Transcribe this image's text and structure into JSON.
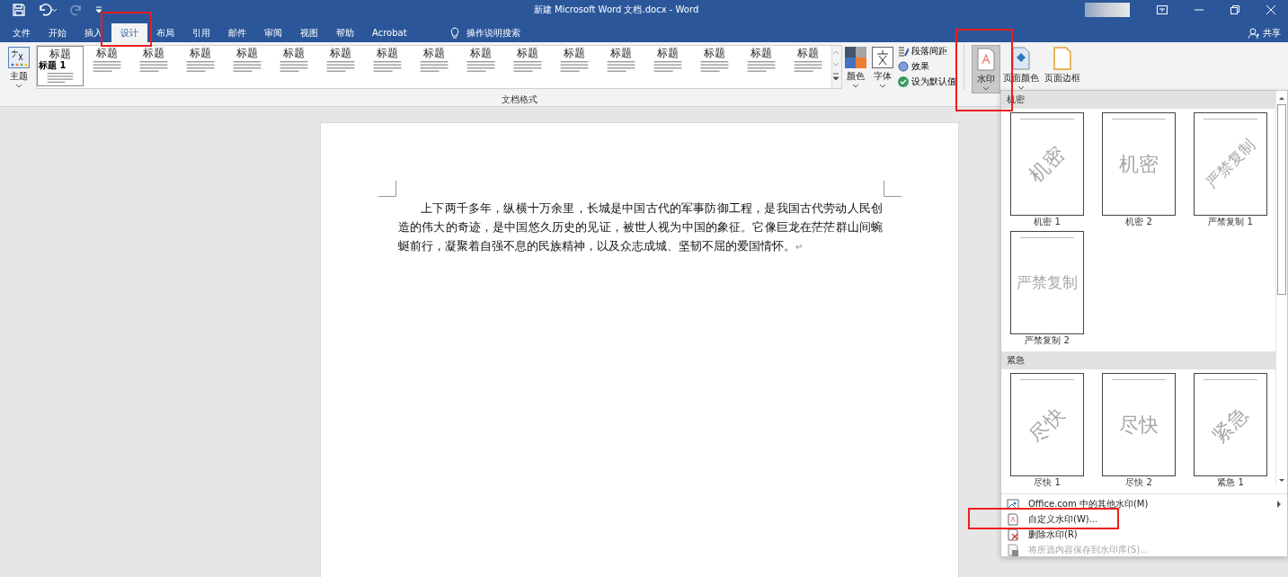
{
  "window": {
    "title": "新建 Microsoft Word 文档.docx  -  Word"
  },
  "tabs": [
    {
      "label": "文件",
      "selected": false,
      "highlighted": false
    },
    {
      "label": "开始",
      "selected": false,
      "highlighted": false
    },
    {
      "label": "插入",
      "selected": false,
      "highlighted": false
    },
    {
      "label": "设计",
      "selected": true,
      "highlighted": true
    },
    {
      "label": "布局",
      "selected": false,
      "highlighted": false
    },
    {
      "label": "引用",
      "selected": false,
      "highlighted": false
    },
    {
      "label": "邮件",
      "selected": false,
      "highlighted": false
    },
    {
      "label": "审阅",
      "selected": false,
      "highlighted": false
    },
    {
      "label": "视图",
      "selected": false,
      "highlighted": false
    },
    {
      "label": "帮助",
      "selected": false,
      "highlighted": false
    },
    {
      "label": "Acrobat",
      "selected": false,
      "highlighted": false
    }
  ],
  "tell_me": {
    "label": "操作说明搜索"
  },
  "share": {
    "label": "共享"
  },
  "ribbon": {
    "theme_button": {
      "label": "主题"
    },
    "style_gallery": [
      {
        "title": "标题",
        "heading": "标题 1"
      },
      {
        "title": "标题"
      },
      {
        "title": "标题"
      },
      {
        "title": "标题"
      },
      {
        "title": "标题"
      },
      {
        "title": "标题"
      },
      {
        "title": "标题"
      },
      {
        "title": "标题"
      },
      {
        "title": "标题"
      },
      {
        "title": "标题"
      },
      {
        "title": "标题"
      },
      {
        "title": "标题"
      },
      {
        "title": "标题"
      },
      {
        "title": "标题"
      },
      {
        "title": "标题"
      },
      {
        "title": "标题"
      },
      {
        "title": "标题"
      }
    ],
    "group_label": "文档格式",
    "colors": {
      "label": "颜色"
    },
    "fonts": {
      "label": "字体"
    },
    "paragraph_spacing": {
      "label": "段落间距"
    },
    "effects": {
      "label": "效果"
    },
    "set_default": {
      "label": "设为默认值"
    },
    "watermark": {
      "label": "水印",
      "pressed": true,
      "highlighted": true
    },
    "page_color": {
      "label": "页面颜色"
    },
    "page_borders": {
      "label": "页面边框"
    }
  },
  "document": {
    "paragraph": "上下两千多年，纵横十万余里，长城是中国古代的军事防御工程，是我国古代劳动人民创造的伟大的奇迹，是中国悠久历史的见证，被世人视为中国的象征。它像巨龙在茫茫群山间蜿蜒前行，凝聚着自强不息的民族精神，以及众志成城、坚韧不屈的爱国情怀。",
    "paragraph_mark": "↵"
  },
  "watermark_menu": {
    "sections": [
      {
        "title": "机密",
        "items": [
          {
            "label": "机密 1",
            "text": "机密",
            "diagonal": true
          },
          {
            "label": "机密 2",
            "text": "机密",
            "diagonal": false
          },
          {
            "label": "严禁复制 1",
            "text": "严禁复制",
            "diagonal": true
          },
          {
            "label": "严禁复制 2",
            "text": "严禁复制",
            "diagonal": false
          }
        ]
      },
      {
        "title": "紧急",
        "items": [
          {
            "label": "尽快 1",
            "text": "尽快",
            "diagonal": true
          },
          {
            "label": "尽快 2",
            "text": "尽快",
            "diagonal": false
          },
          {
            "label": "紧急 1",
            "text": "紧急",
            "diagonal": true
          }
        ]
      }
    ],
    "commands": [
      {
        "label": "Office.com 中的其他水印(M)",
        "kind": "online",
        "disabled": false,
        "submenu": true,
        "highlighted": false
      },
      {
        "label": "自定义水印(W)...",
        "kind": "custom",
        "disabled": false,
        "submenu": false,
        "highlighted": true
      },
      {
        "label": "删除水印(R)",
        "kind": "remove",
        "disabled": false,
        "submenu": false,
        "highlighted": false
      },
      {
        "label": "将所选内容保存到水印库(S)...",
        "kind": "save",
        "disabled": true,
        "submenu": false,
        "highlighted": false
      }
    ]
  }
}
